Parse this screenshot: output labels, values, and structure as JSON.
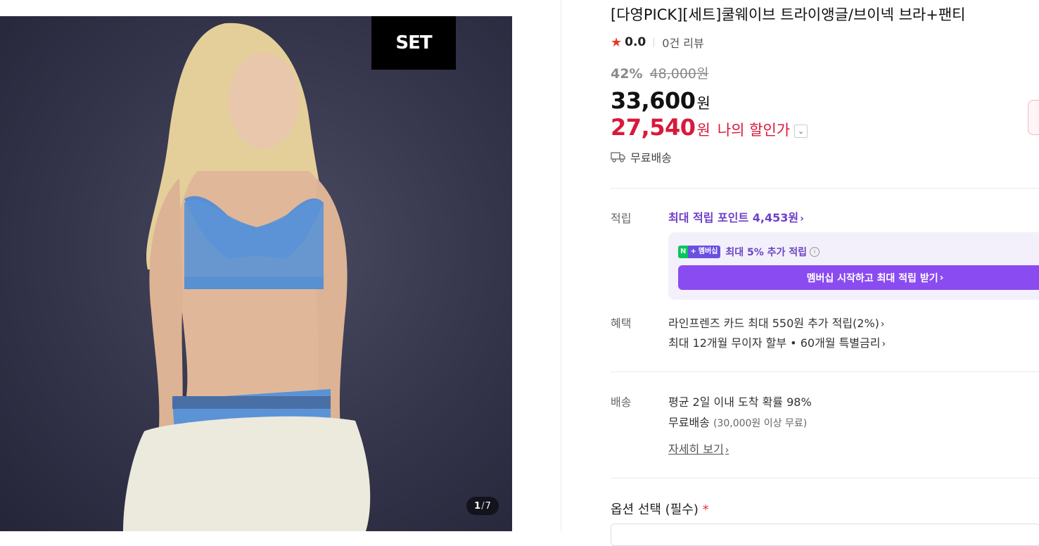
{
  "gallery": {
    "badge": "SET",
    "current": "1",
    "separator": "/",
    "total": "7"
  },
  "product": {
    "title": "[다영PICK][세트]쿨웨이브 트라이앵글/브이넥 브라+팬티",
    "rating": "0.0",
    "reviews": "0건 리뷰",
    "discount_rate": "42%",
    "original_price": "48,000원",
    "price": "33,600",
    "price_unit": "원",
    "my_price": "27,540",
    "my_price_unit": "원",
    "my_price_label": "나의 할인가",
    "shipping_badge": "무료배송"
  },
  "points": {
    "label": "적립",
    "max_points": "최대 적립 포인트 4,453원",
    "membership_n": "N",
    "membership_plus": "+",
    "membership_badge": "멤버십",
    "membership_text": "최대 5% 추가 적립",
    "membership_button": "멤버십 시작하고 최대 적립 받기"
  },
  "benefits": {
    "label": "혜택",
    "line1": "라인프렌즈 카드 최대 550원 추가 적립(2%)",
    "line2": "최대 12개월 무이자 할부 • 60개월 특별금리"
  },
  "delivery": {
    "label": "배송",
    "arrival": "평균 2일 이내 도착 확률 98%",
    "free": "무료배송",
    "free_condition": "(30,000원 이상 무료)",
    "more": "자세히 보기"
  },
  "options": {
    "label": "옵션 선택 (필수)",
    "required_mark": "*"
  },
  "colors": {
    "accent_red": "#d8193a",
    "points_purple": "#6f3fc8",
    "membership_button": "#8a4bf0",
    "star": "#e8382e",
    "naver_green": "#03c75a"
  }
}
